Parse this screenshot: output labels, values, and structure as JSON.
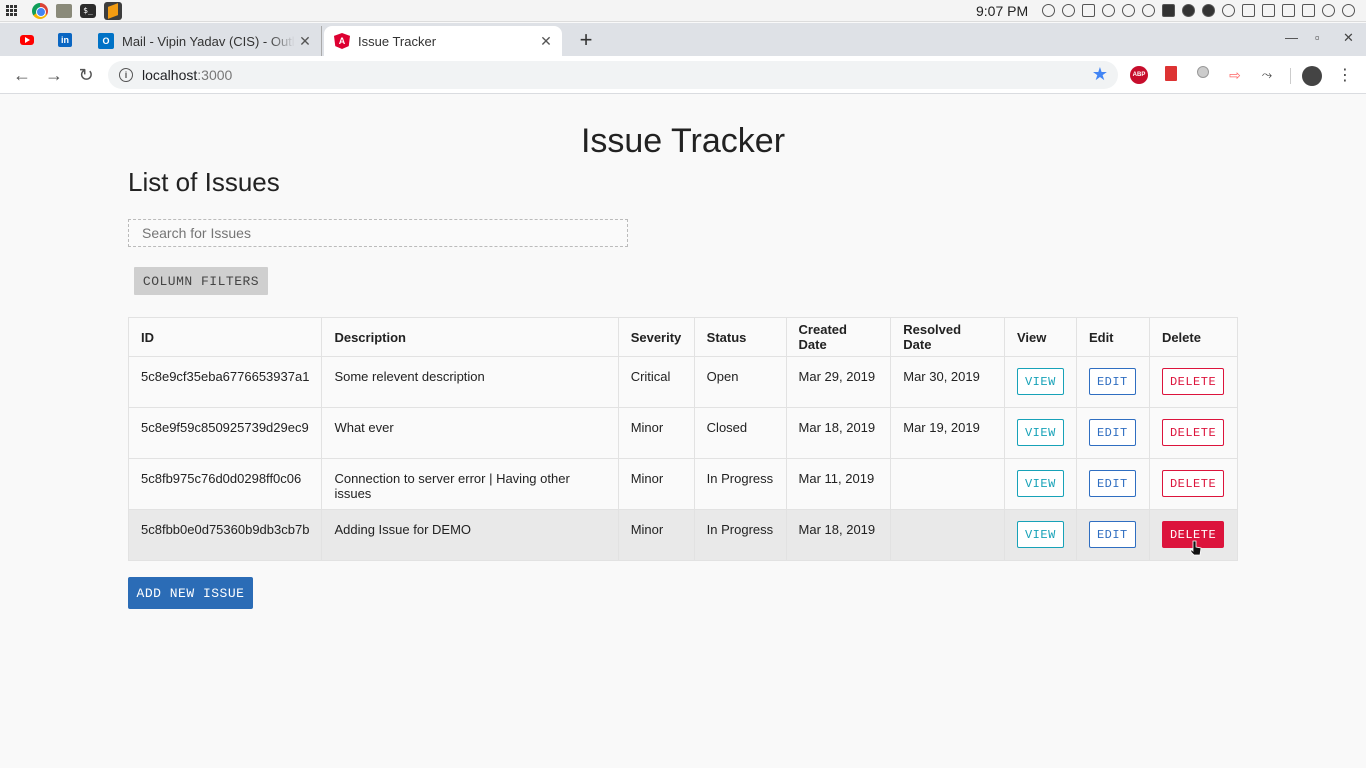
{
  "os": {
    "clock": "9:07 PM"
  },
  "browser": {
    "tabs": [
      {
        "title": "Mail - Vipin Yadav (CIS) - Outlook",
        "favicon": "outlook-icon"
      },
      {
        "title": "Issue Tracker",
        "favicon": "angular-icon",
        "active": true
      }
    ],
    "url_host": "localhost",
    "url_port": ":3000"
  },
  "page": {
    "title": "Issue Tracker",
    "list_title": "List of Issues",
    "search_placeholder": "Search for Issues",
    "column_filters_label": "COLUMN FILTERS",
    "add_button_label": "ADD NEW ISSUE"
  },
  "table": {
    "headers": [
      "ID",
      "Description",
      "Severity",
      "Status",
      "Created Date",
      "Resolved Date",
      "View",
      "Edit",
      "Delete"
    ],
    "view_label": "VIEW",
    "edit_label": "EDIT",
    "delete_label": "DELETE",
    "rows": [
      {
        "id": "5c8e9cf35eba6776653937a1",
        "description": "Some relevent description",
        "severity": "Critical",
        "status": "Open",
        "created": "Mar 29, 2019",
        "resolved": "Mar 30, 2019"
      },
      {
        "id": "5c8e9f59c850925739d29ec9",
        "description": "What ever",
        "severity": "Minor",
        "status": "Closed",
        "created": "Mar 18, 2019",
        "resolved": "Mar 19, 2019"
      },
      {
        "id": "5c8fb975c76d0d0298ff0c06",
        "description": "Connection to server error | Having other issues",
        "severity": "Minor",
        "status": "In Progress",
        "created": "Mar 11, 2019",
        "resolved": ""
      },
      {
        "id": "5c8fbb0e0d75360b9db3cb7b",
        "description": "Adding Issue for DEMO",
        "severity": "Minor",
        "status": "In Progress",
        "created": "Mar 18, 2019",
        "resolved": ""
      }
    ]
  },
  "colors": {
    "view": "#17a2b8",
    "edit": "#2f6ec1",
    "delete": "#dc143c",
    "primary": "#2b6cb6"
  }
}
